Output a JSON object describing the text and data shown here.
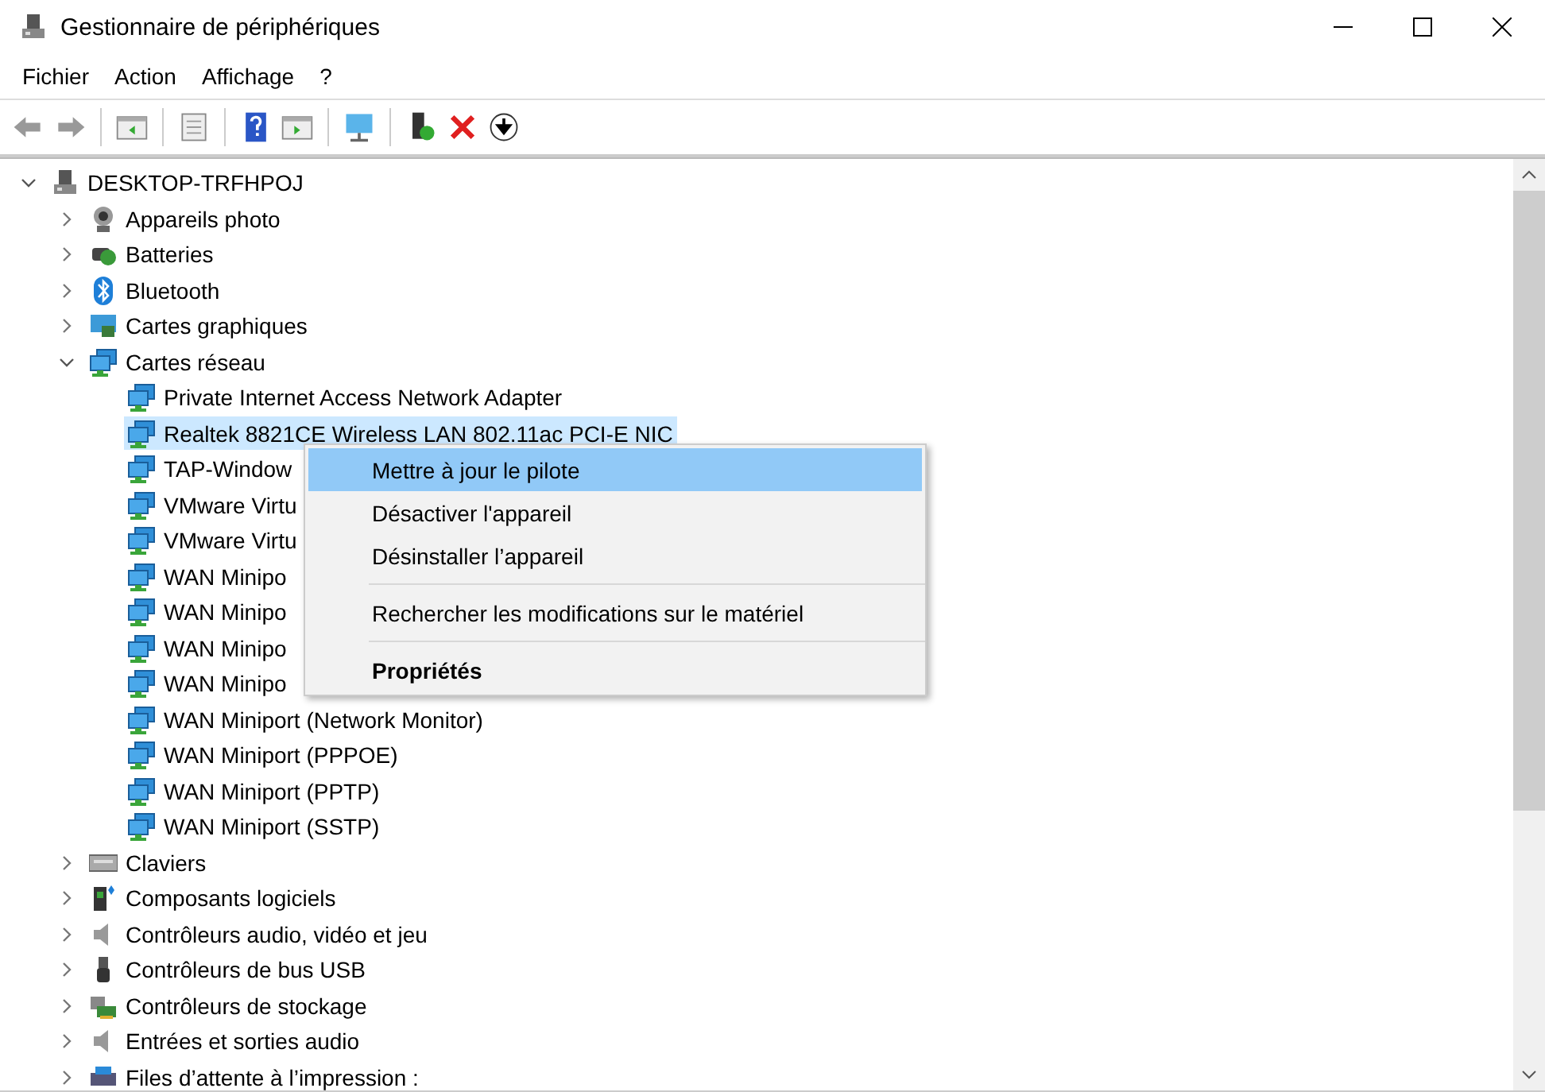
{
  "window": {
    "title": "Gestionnaire de périphériques"
  },
  "menu_bar": [
    {
      "label": "Fichier"
    },
    {
      "label": "Action"
    },
    {
      "label": "Affichage"
    },
    {
      "label": "?"
    }
  ],
  "tree": {
    "label": "DESKTOP-TRFHPOJ",
    "kind": "computer",
    "expanded": true,
    "selected": false,
    "children": [
      {
        "label": "Appareils photo",
        "kind": "camera",
        "expanded": false,
        "selected": false
      },
      {
        "label": "Batteries",
        "kind": "battery",
        "expanded": false,
        "selected": false
      },
      {
        "label": "Bluetooth",
        "kind": "bluetooth",
        "expanded": false,
        "selected": false
      },
      {
        "label": "Cartes graphiques",
        "kind": "display",
        "expanded": false,
        "selected": false
      },
      {
        "label": "Cartes réseau",
        "kind": "network",
        "expanded": true,
        "selected": false,
        "children": [
          {
            "label": "Private Internet Access Network Adapter",
            "kind": "network",
            "selected": false
          },
          {
            "label": "Realtek 8821CE Wireless LAN 802.11ac PCI-E NIC",
            "kind": "network",
            "selected": true
          },
          {
            "label": "TAP-Window",
            "kind": "network",
            "selected": false
          },
          {
            "label": "VMware Virtu",
            "kind": "network",
            "selected": false
          },
          {
            "label": "VMware Virtu",
            "kind": "network",
            "selected": false
          },
          {
            "label": "WAN Minipo",
            "kind": "network",
            "selected": false
          },
          {
            "label": "WAN Minipo",
            "kind": "network",
            "selected": false
          },
          {
            "label": "WAN Minipo",
            "kind": "network",
            "selected": false
          },
          {
            "label": "WAN Minipo",
            "kind": "network",
            "selected": false
          },
          {
            "label": "WAN Miniport (Network Monitor)",
            "kind": "network",
            "selected": false
          },
          {
            "label": "WAN Miniport (PPPOE)",
            "kind": "network",
            "selected": false
          },
          {
            "label": "WAN Miniport (PPTP)",
            "kind": "network",
            "selected": false
          },
          {
            "label": "WAN Miniport (SSTP)",
            "kind": "network",
            "selected": false
          }
        ]
      },
      {
        "label": "Claviers",
        "kind": "keyboard",
        "expanded": false,
        "selected": false
      },
      {
        "label": "Composants logiciels",
        "kind": "software",
        "expanded": false,
        "selected": false
      },
      {
        "label": "Contrôleurs audio, vidéo et jeu",
        "kind": "audio",
        "expanded": false,
        "selected": false
      },
      {
        "label": "Contrôleurs de bus USB",
        "kind": "usb",
        "expanded": false,
        "selected": false
      },
      {
        "label": "Contrôleurs de stockage",
        "kind": "storage",
        "expanded": false,
        "selected": false
      },
      {
        "label": "Entrées et sorties audio",
        "kind": "audio",
        "expanded": false,
        "selected": false
      },
      {
        "label": "Files d’attente à l’impression :",
        "kind": "printer",
        "expanded": false,
        "selected": false
      }
    ]
  },
  "context_menu": {
    "items": [
      {
        "kind": "item",
        "label": "Mettre à jour le pilote",
        "selected": true,
        "default": false
      },
      {
        "kind": "item",
        "label": "Désactiver l'appareil",
        "selected": false,
        "default": false
      },
      {
        "kind": "item",
        "label": "Désinstaller l’appareil",
        "selected": false,
        "default": false
      },
      {
        "kind": "separator"
      },
      {
        "kind": "item",
        "label": "Rechercher les modifications sur le matériel",
        "selected": false,
        "default": false
      },
      {
        "kind": "separator"
      },
      {
        "kind": "item",
        "label": "Propriétés",
        "selected": false,
        "default": true
      }
    ]
  }
}
